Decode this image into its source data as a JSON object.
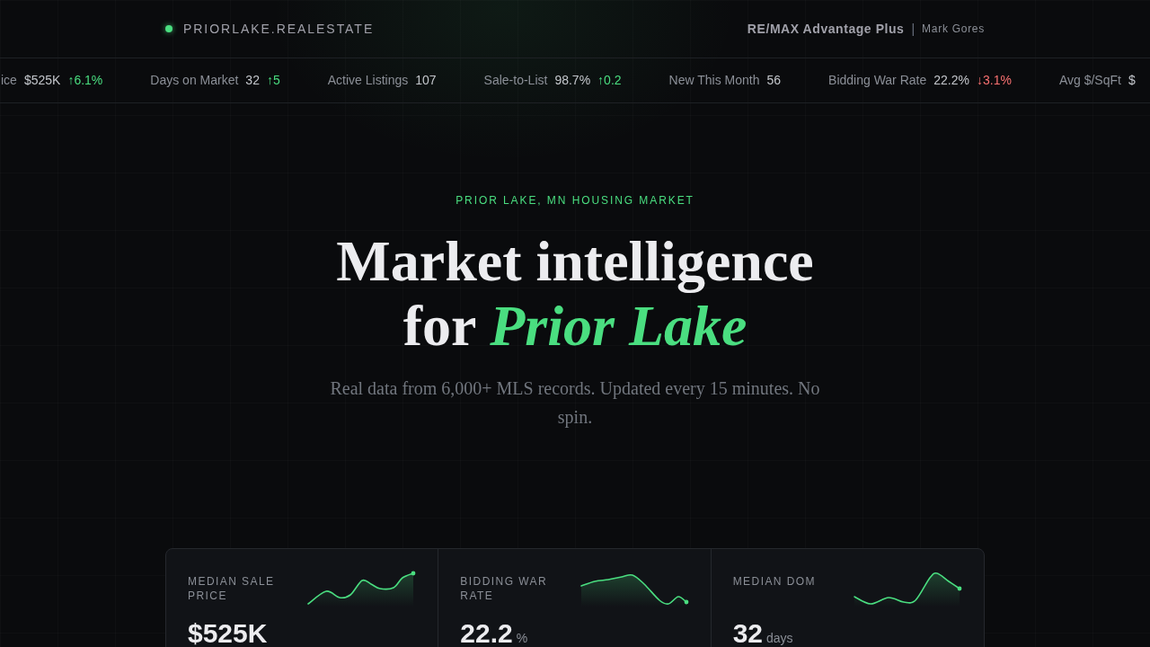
{
  "header": {
    "brand": "PRIORLAKE.REALESTATE",
    "brokerage": "RE/MAX Advantage Plus",
    "separator": "|",
    "agent": "Mark Gores"
  },
  "ticker": [
    {
      "label": "ice",
      "value": "$525K",
      "change": "↑6.1%",
      "rising": true
    },
    {
      "label": "Days on Market",
      "value": "32",
      "change": "↑5",
      "rising": true
    },
    {
      "label": "Active Listings",
      "value": "107"
    },
    {
      "label": "Sale-to-List",
      "value": "98.7%",
      "change": "↑0.2",
      "rising": true
    },
    {
      "label": "New This Month",
      "value": "56"
    },
    {
      "label": "Bidding War Rate",
      "value": "22.2%",
      "change": "↓3.1%",
      "rising": false
    },
    {
      "label": "Avg $/SqFt",
      "value": "$"
    }
  ],
  "hero": {
    "eyebrow": "PRIOR LAKE, MN HOUSING MARKET",
    "title": "Market intelligence for *Prior Lake*",
    "subtitle": "Real data from 6,000+ MLS records. Updated every 15 minutes. No spin."
  },
  "stats": [
    {
      "label": "MEDIAN SALE PRICE",
      "value": "$525K"
    },
    {
      "label": "BIDDING WAR RATE",
      "value": "22.2",
      "unit": "%"
    },
    {
      "label": "MEDIAN DOM",
      "value": "32",
      "unit": "days"
    }
  ]
}
